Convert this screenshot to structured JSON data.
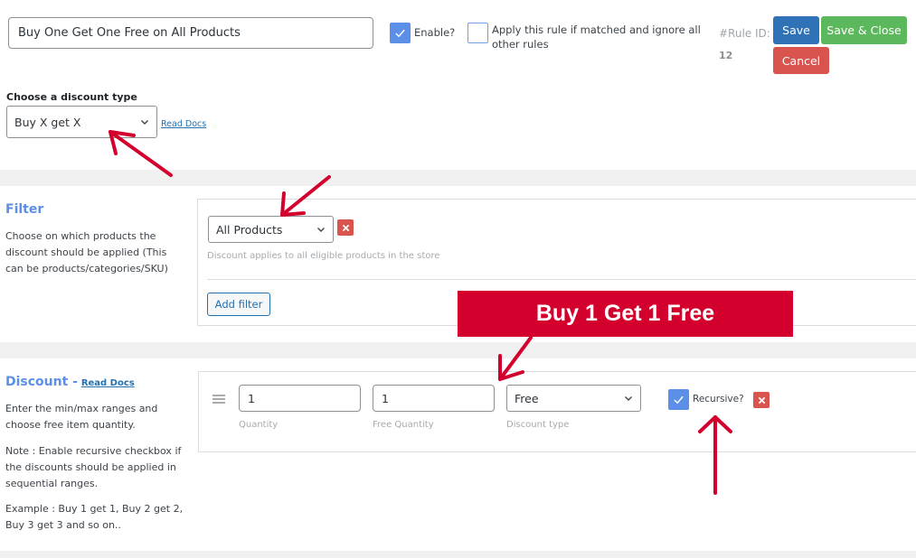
{
  "header": {
    "rule_title_value": "Buy One Get One Free on All Products",
    "enable_label": "Enable?",
    "enable_checked": true,
    "exclusive_label_line1": "Apply this rule if matched and ignore all",
    "exclusive_label_line2": "other rules",
    "exclusive_checked": false,
    "rule_id_label": "#Rule ID:",
    "rule_id_value": "12",
    "save_label": "Save",
    "save_close_label": "Save & Close",
    "cancel_label": "Cancel"
  },
  "discount_type": {
    "label": "Choose a discount type",
    "selected": "Buy X get X",
    "read_docs": "Read Docs"
  },
  "filter": {
    "title": "Filter",
    "description": "Choose on which products the discount should be applied (This can be products/categories/SKU)",
    "selected": "All Products",
    "hint": "Discount applies to all eligible products in the store",
    "add_filter_label": "Add filter"
  },
  "discount": {
    "title": "Discount -",
    "read_docs": "Read Docs",
    "desc1": "Enter the min/max ranges and choose free item quantity.",
    "desc2": "Note : Enable recursive checkbox if the discounts should be applied in sequential ranges.",
    "desc3": "Example : Buy 1 get 1, Buy 2 get 2, Buy 3 get 3 and so on..",
    "quantity_value": "1",
    "quantity_label": "Quantity",
    "free_quantity_value": "1",
    "free_quantity_label": "Free Quantity",
    "discount_type_value": "Free",
    "discount_type_label": "Discount type",
    "recursive_label": "Recursive?",
    "recursive_checked": true
  },
  "annotation": {
    "banner_text": "Buy 1 Get 1 Free",
    "arrow_color": "#d3002d"
  },
  "colors": {
    "accent_blue": "#5b8fe8",
    "save_blue": "#2f72b8",
    "save_close_green": "#5cb85c",
    "cancel_red": "#d9534f"
  }
}
